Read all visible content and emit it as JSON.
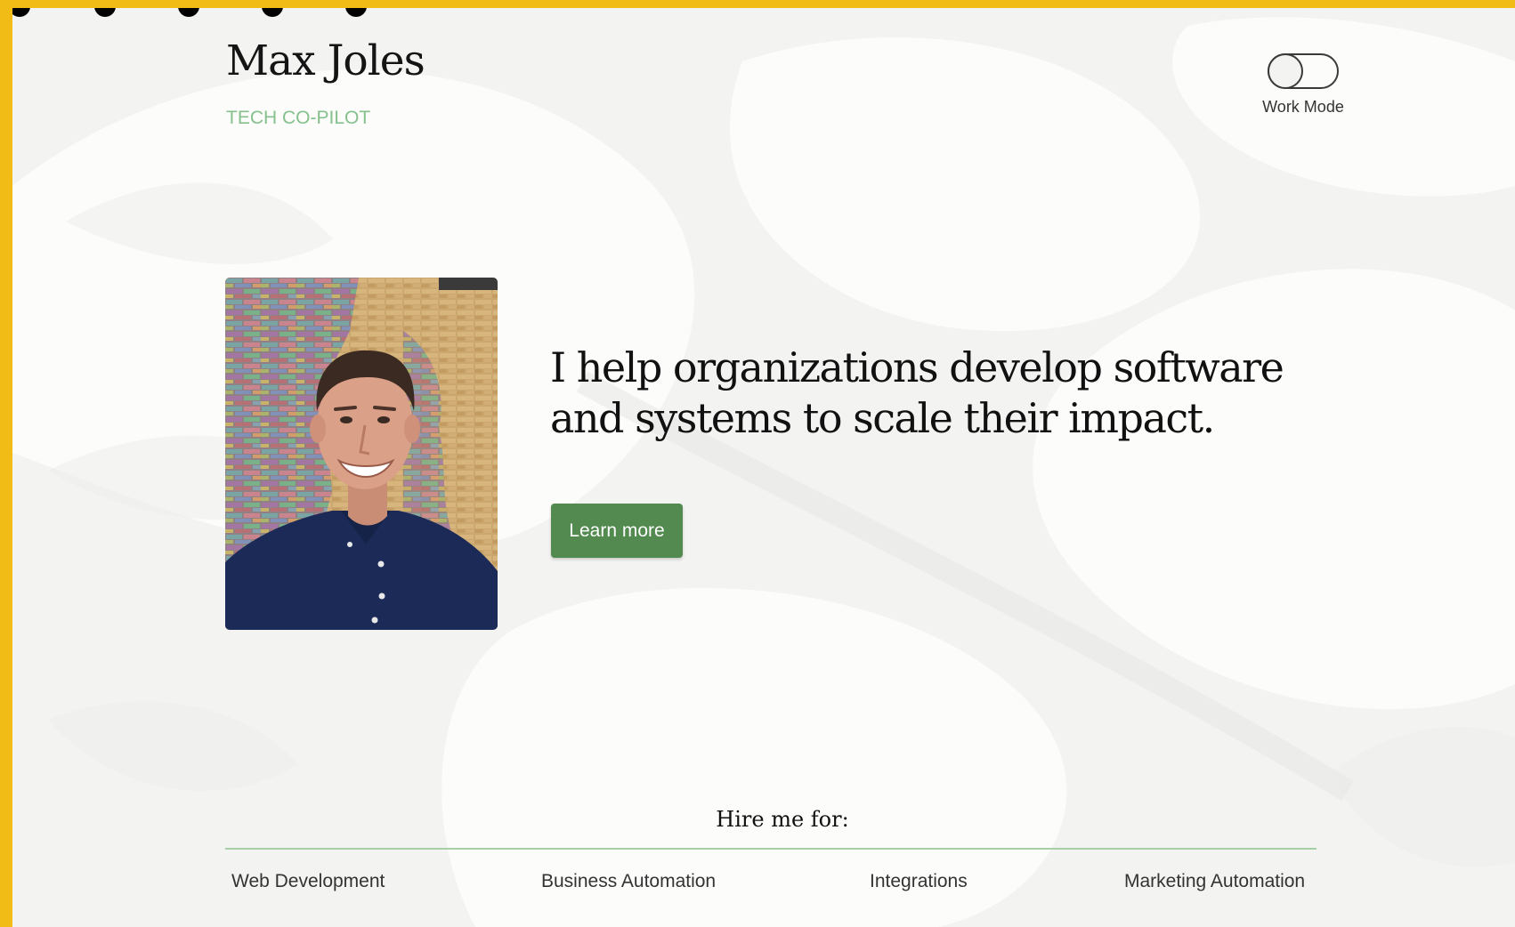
{
  "header": {
    "name": "Max Joles",
    "tagline": "TECH CO-PILOT"
  },
  "mode_toggle": {
    "label": "Work Mode",
    "state": "off"
  },
  "hero": {
    "headline": "I help organizations develop software and systems to scale their impact.",
    "cta_label": "Learn more"
  },
  "hire": {
    "heading": "Hire me for:",
    "services": [
      "Web Development",
      "Business Automation",
      "Integrations",
      "Marketing Automation"
    ]
  },
  "colors": {
    "page_frame": "#f1bc16",
    "accent_green": "#528a4f",
    "tagline_green": "#86c18d",
    "divider_green": "#a6cfa6"
  }
}
